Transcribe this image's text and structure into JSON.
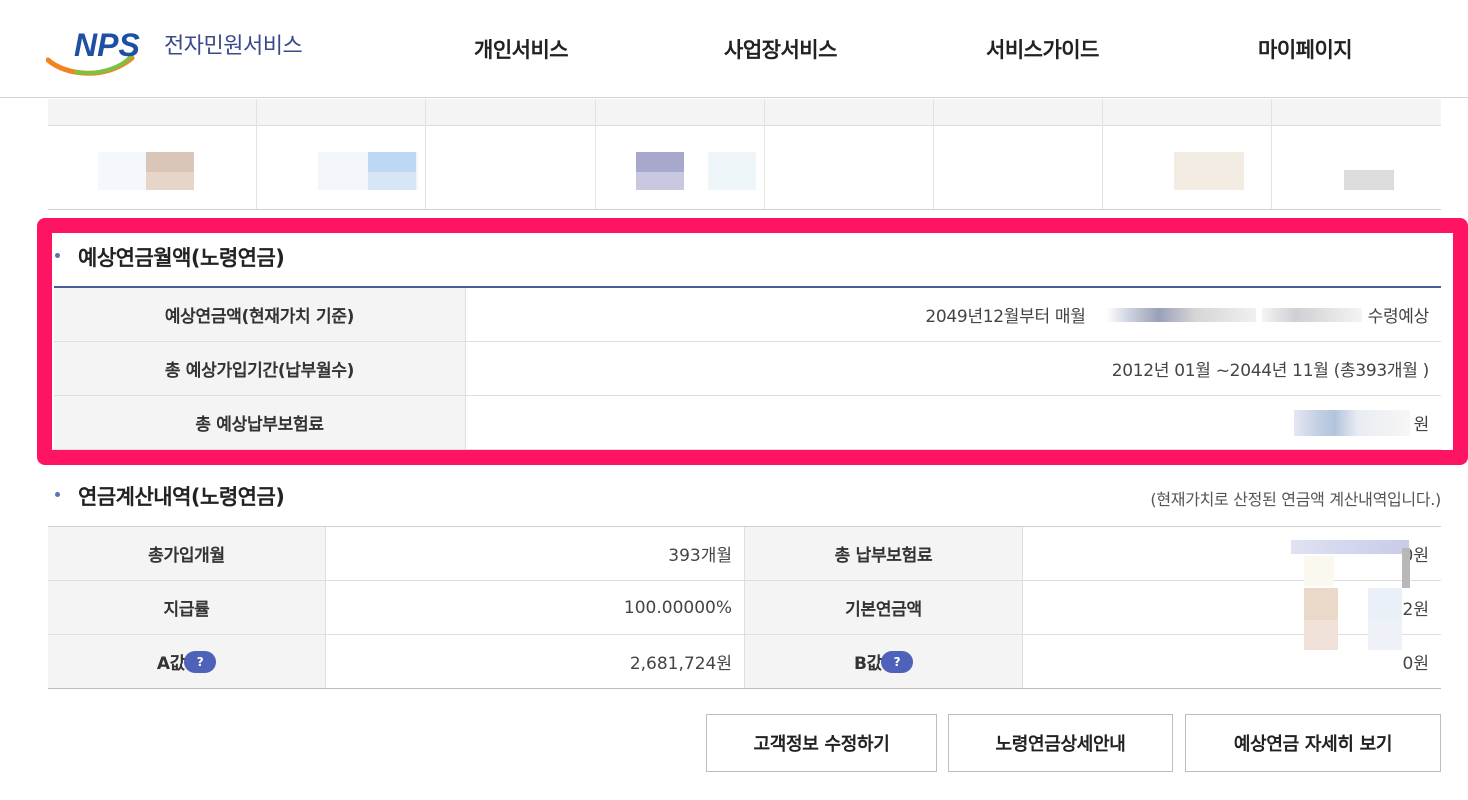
{
  "header": {
    "logo_text": "전자민원서비스",
    "nav": [
      "개인서비스",
      "사업장서비스",
      "서비스가이드",
      "마이페이지"
    ]
  },
  "expected": {
    "title": "예상연금월액(노령연금)",
    "rows": [
      {
        "label": "예상연금액(현재가치 기준)",
        "value": "2049년12월부터 매월",
        "value_suffix": "수령예상"
      },
      {
        "label": "총 예상가입기간(납부월수)",
        "value": "2012년 01월 ~2044년 11월 (총393개월 )"
      },
      {
        "label": "총 예상납부보험료",
        "value": "원"
      }
    ]
  },
  "calc": {
    "title": "연금계산내역(노령연금)",
    "note": "(현재가치로 산정된 연금액 계산내역입니다.)",
    "rows": [
      {
        "l1": "총가입개월",
        "v1": "393개월",
        "l2": "총 납부보험료",
        "v2": "0원"
      },
      {
        "l1": "지급률",
        "v1": "100.00000%",
        "l2": "기본연금액",
        "v2": "2원"
      },
      {
        "l1": "A값",
        "v1": "2,681,724원",
        "l2": "B값",
        "v2": "0원"
      }
    ],
    "help_glyph": "?"
  },
  "buttons": {
    "edit": "고객정보 수정하기",
    "guide": "노령연금상세안내",
    "detail": "예상연금 자세히 보기"
  },
  "colors": {
    "highlight": "#ff1463",
    "accent": "#4d62b8",
    "logo_blue": "#1d4fa5",
    "logo_orange": "#f58220",
    "logo_green": "#7cc242"
  }
}
